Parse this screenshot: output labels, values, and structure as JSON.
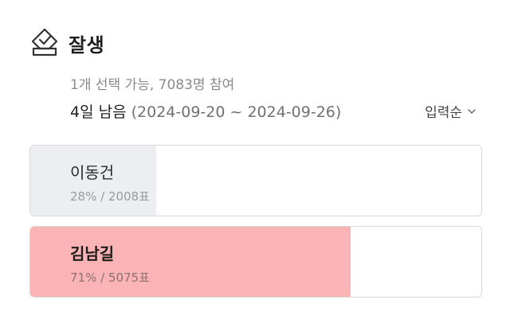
{
  "poll": {
    "title": "잘생",
    "icon": "ballot-check-icon",
    "meta": "1개 선택 가능, 7083명 참여",
    "deadline_remaining": "4일 남음",
    "deadline_range": "(2024-09-20 ~ 2024-09-26)",
    "sort_label": "입력순",
    "sort_icon": "chevron-down-icon"
  },
  "options": [
    {
      "name": "이동건",
      "stats": "28% / 2008표",
      "percent": 28,
      "votes": 2008,
      "fill_color": "#eceef1",
      "selected": false
    },
    {
      "name": "김남길",
      "stats": "71% / 5075표",
      "percent": 71,
      "votes": 5075,
      "fill_color": "#fbb4b5",
      "selected": true
    }
  ]
}
